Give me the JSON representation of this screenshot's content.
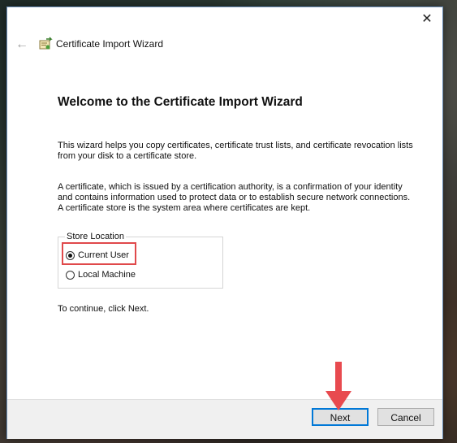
{
  "window": {
    "close_glyph": "✕"
  },
  "header": {
    "back_glyph": "←",
    "icon": "certificate-icon",
    "title": "Certificate Import Wizard"
  },
  "main": {
    "heading": "Welcome to the Certificate Import Wizard",
    "para1": "This wizard helps you copy certificates, certificate trust lists, and certificate revocation lists from your disk to a certificate store.",
    "para2": "A certificate, which is issued by a certification authority, is a confirmation of your identity and contains information used to protect data or to establish secure network connections. A certificate store is the system area where certificates are kept.",
    "store_location": {
      "label": "Store Location",
      "options": [
        "Current User",
        "Local Machine"
      ],
      "selected": "Current User"
    },
    "continue_text": "To continue, click Next."
  },
  "footer": {
    "next_label": "Next",
    "cancel_label": "Cancel"
  },
  "colors": {
    "highlight": "#e0494b",
    "arrow": "#e84a4f",
    "accent": "#0078d7"
  }
}
